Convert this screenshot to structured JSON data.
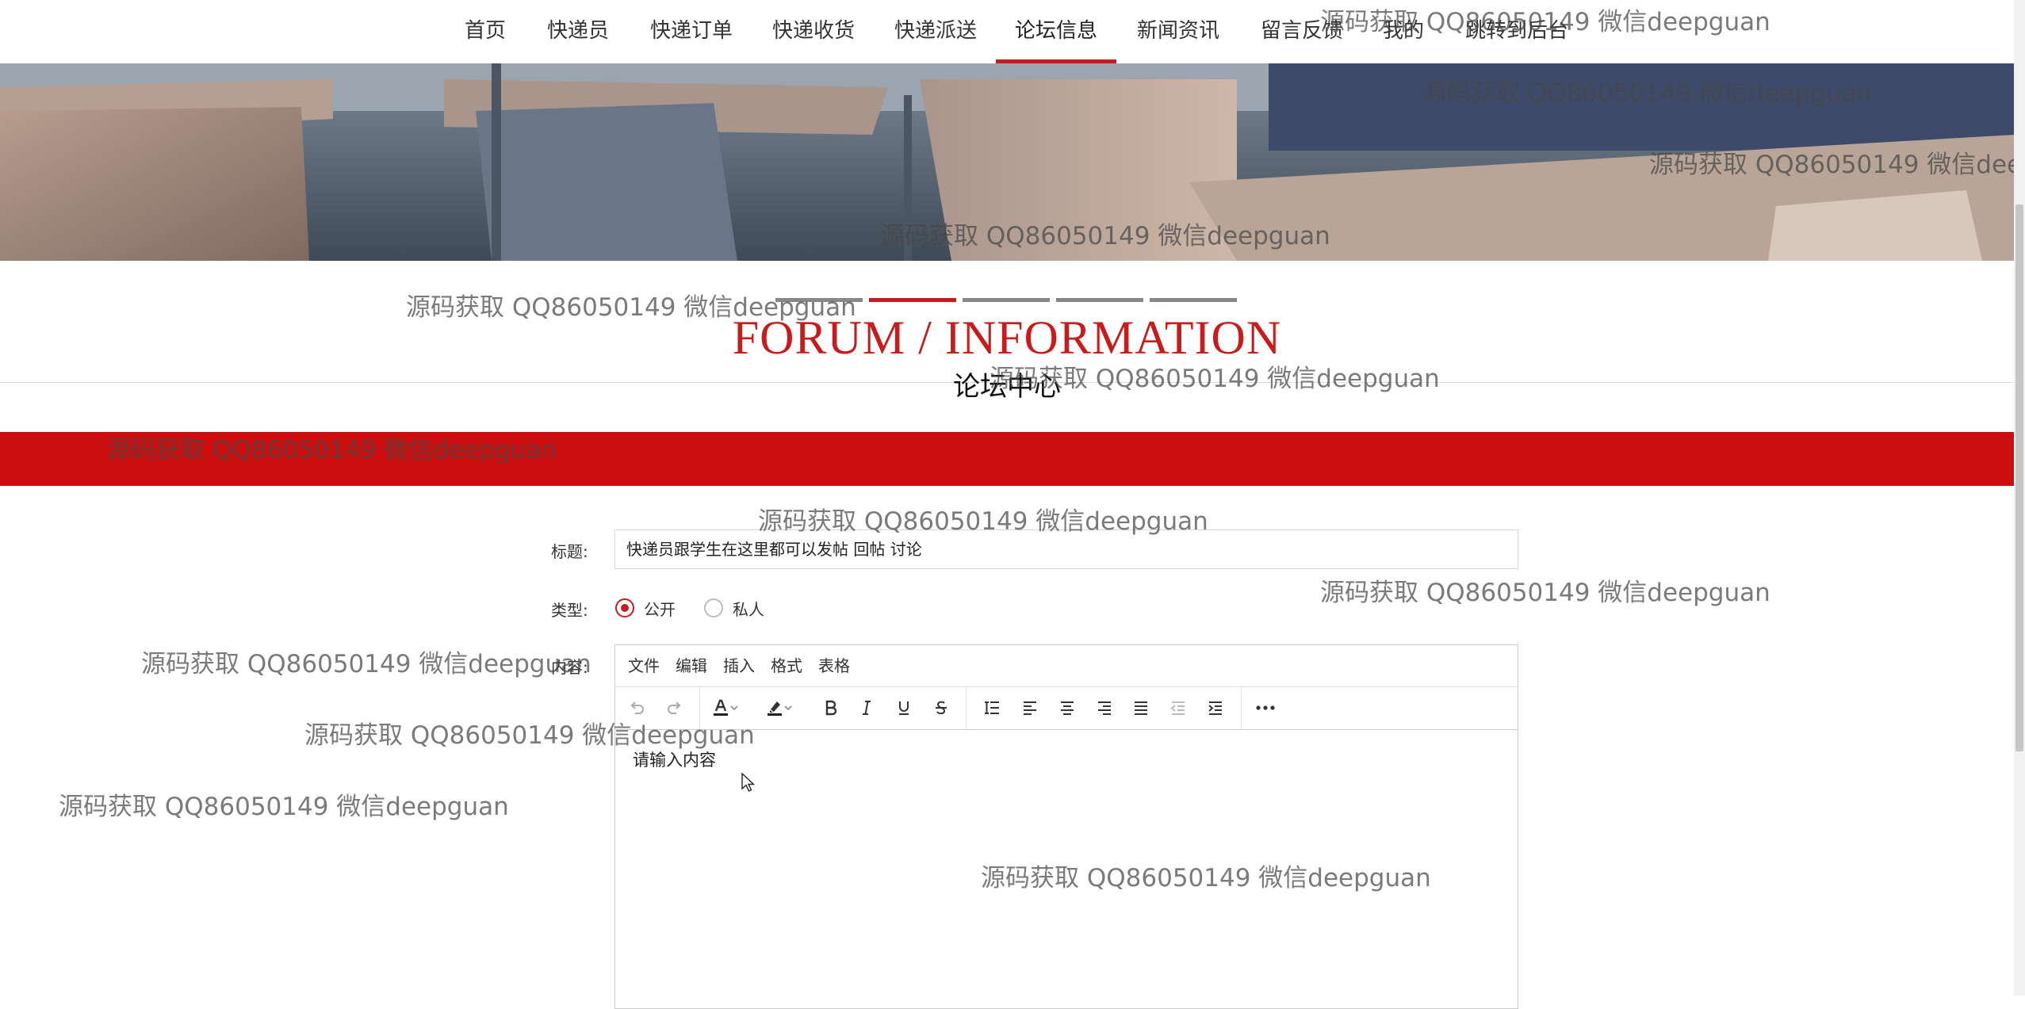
{
  "nav": {
    "items": [
      "首页",
      "快递员",
      "快递订单",
      "快递收货",
      "快递派送",
      "论坛信息",
      "新闻资讯",
      "留言反馈",
      "我的",
      "跳转到后台"
    ],
    "active_index": 5
  },
  "carousel": {
    "slide_count": 5,
    "active_index": 1
  },
  "section": {
    "title_en": "FORUM / INFORMATION",
    "title_cn": "论坛中心"
  },
  "form": {
    "title_label": "标题:",
    "title_value": "快递员跟学生在这里都可以发帖  回帖  讨论",
    "type_label": "类型:",
    "type_options": [
      "公开",
      "私人"
    ],
    "type_selected": "公开",
    "content_label": "内容:"
  },
  "editor": {
    "menus": [
      "文件",
      "编辑",
      "插入",
      "格式",
      "表格"
    ],
    "toolbar_icons": [
      "undo-icon",
      "redo-icon",
      "text-color-icon",
      "highlight-color-icon",
      "bold-icon",
      "italic-icon",
      "underline-icon",
      "strikethrough-icon",
      "line-height-icon",
      "align-left-icon",
      "align-center-icon",
      "align-right-icon",
      "align-justify-icon",
      "outdent-icon",
      "indent-icon",
      "more-icon"
    ],
    "placeholder": "请输入内容"
  },
  "watermark_text": "源码获取 QQ86050149 微信deepguan",
  "colors": {
    "accent": "#c81b1b",
    "red_bar": "#cc0e0e"
  }
}
